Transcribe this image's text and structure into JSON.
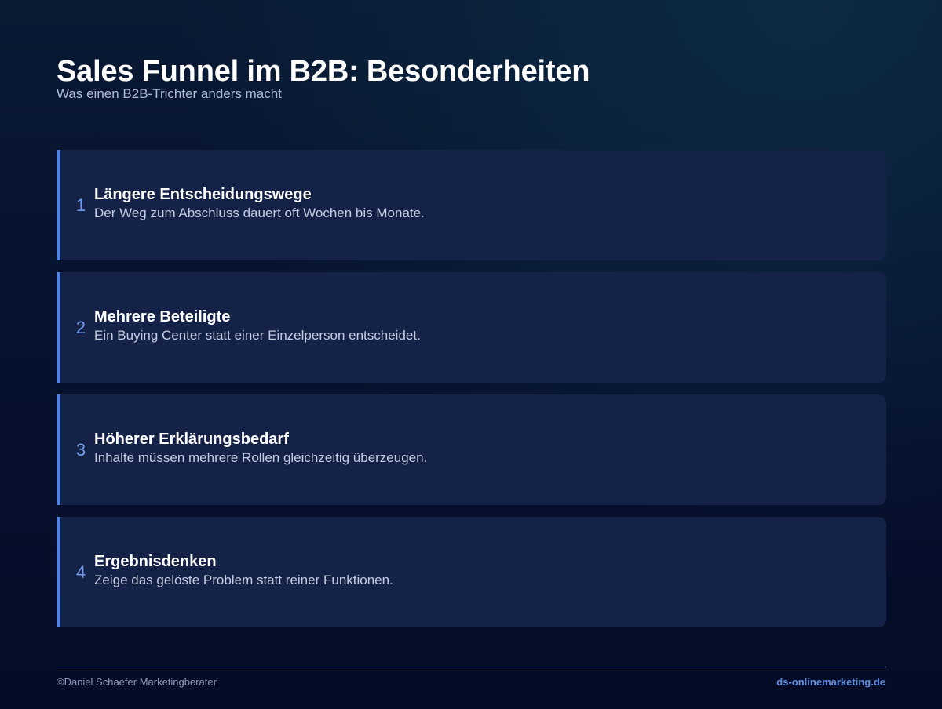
{
  "header": {
    "title": "Sales Funnel im B2B: Besonderheiten",
    "subtitle": "Was einen B2B-Trichter anders macht"
  },
  "cards": [
    {
      "number": "1",
      "title": "Längere Entscheidungswege",
      "description": "Der Weg zum Abschluss dauert oft Wochen bis Monate."
    },
    {
      "number": "2",
      "title": "Mehrere Beteiligte",
      "description": "Ein Buying Center statt einer Einzelperson entscheidet."
    },
    {
      "number": "3",
      "title": "Höherer Erklärungsbedarf",
      "description": "Inhalte müssen mehrere Rollen gleichzeitig überzeugen."
    },
    {
      "number": "4",
      "title": "Ergebnisdenken",
      "description": "Zeige das gelöste Problem statt reiner Funktionen."
    }
  ],
  "footer": {
    "copyright": "©Daniel Schaefer Marketingberater",
    "website": "ds-onlinemarketing.de"
  },
  "colors": {
    "background": "#061230",
    "card_background": "#152248",
    "accent": "#4f84e3",
    "number": "#6f9bec",
    "link": "#5f8de0"
  }
}
